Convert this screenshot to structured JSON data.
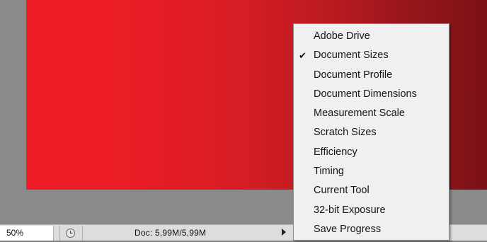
{
  "statusbar": {
    "zoom": "50%",
    "doc_info": "Doc: 5,99M/5,99M",
    "history_icon": "clock-icon",
    "menu_arrow_icon": "triangle-right-icon"
  },
  "popup_menu": {
    "check_glyph": "✔",
    "items": [
      {
        "label": "Adobe Drive",
        "checked": false
      },
      {
        "label": "Document Sizes",
        "checked": true
      },
      {
        "label": "Document Profile",
        "checked": false
      },
      {
        "label": "Document Dimensions",
        "checked": false
      },
      {
        "label": "Measurement Scale",
        "checked": false
      },
      {
        "label": "Scratch Sizes",
        "checked": false
      },
      {
        "label": "Efficiency",
        "checked": false
      },
      {
        "label": "Timing",
        "checked": false
      },
      {
        "label": "Current Tool",
        "checked": false
      },
      {
        "label": "32-bit Exposure",
        "checked": false
      },
      {
        "label": "Save Progress",
        "checked": false
      }
    ]
  },
  "colors": {
    "document_left": "#ee1c25",
    "document_right": "#7a1116",
    "workspace": "#8a8a8a",
    "statusbar": "#dddddd",
    "menu_bg": "#f0f0f0"
  }
}
